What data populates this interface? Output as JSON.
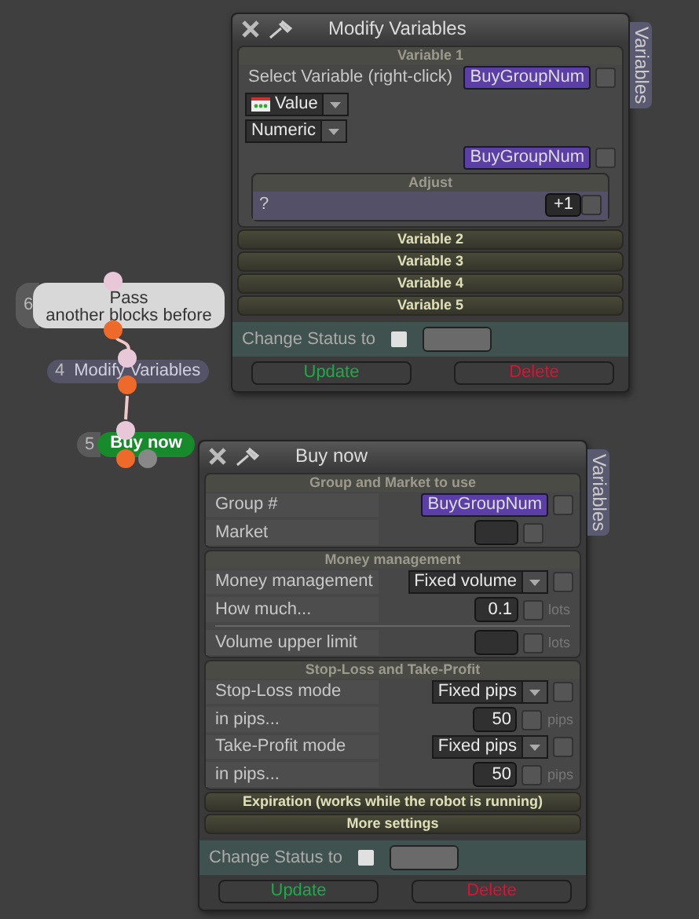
{
  "nodes": [
    {
      "number": "6",
      "label": "Pass\nanother blocks before",
      "kind": "light",
      "extra_port": false
    },
    {
      "number": "4",
      "label": "Modify Variables",
      "kind": "dark",
      "extra_port": false
    },
    {
      "number": "5",
      "label": "Buy now",
      "kind": "action",
      "extra_port": true
    }
  ],
  "dialogs": [
    {
      "kind": "variables",
      "title": "Modify Variables",
      "side_tab": "Variables",
      "sections": [
        {
          "title": "Variable 1",
          "expanded": true,
          "rows": [
            {
              "kind": "variable",
              "label": "Select Variable (right-click)",
              "value": "BuyGroupNum",
              "checked": false
            },
            {
              "kind": "type-dropdown",
              "value": "Value"
            },
            {
              "kind": "dropdown",
              "value": "Numeric"
            },
            {
              "kind": "variable",
              "value": "BuyGroupNum",
              "checked": false
            },
            {
              "kind": "adjust",
              "title": "Adjust",
              "value": "?",
              "button": "+1",
              "checked": false
            }
          ]
        },
        {
          "title": "Variable 2",
          "expanded": false
        },
        {
          "title": "Variable 3",
          "expanded": false
        },
        {
          "title": "Variable 4",
          "expanded": false
        },
        {
          "title": "Variable 5",
          "expanded": false
        }
      ],
      "status": {
        "label": "Change Status to",
        "checked": false
      },
      "buttons": [
        {
          "label": "Update",
          "kind": "update"
        },
        {
          "label": "Delete",
          "kind": "delete"
        }
      ]
    },
    {
      "kind": "action",
      "title": "Buy now",
      "side_tab": "Variables",
      "sections": [
        {
          "title": "Group and Market to use",
          "expanded": true,
          "rows": [
            {
              "kind": "variable",
              "label": "Group #",
              "value": "BuyGroupNum",
              "checked": false
            },
            {
              "kind": "field",
              "label": "Market",
              "checked": false
            }
          ]
        },
        {
          "title": "Money management",
          "expanded": true,
          "rows": [
            {
              "kind": "dropdown",
              "label": "Money management",
              "value": "Fixed volume",
              "checked": false
            },
            {
              "kind": "field",
              "label": "How much...",
              "value": "0.1",
              "unit": "lots",
              "checked": false
            },
            {
              "kind": "divider"
            },
            {
              "kind": "field",
              "label": "Volume upper limit",
              "unit": "lots",
              "checked": false
            }
          ]
        },
        {
          "title": "Stop-Loss and Take-Profit",
          "expanded": true,
          "rows": [
            {
              "kind": "dropdown",
              "label": "Stop-Loss mode",
              "value": "Fixed pips",
              "checked": false
            },
            {
              "kind": "field",
              "label": "in pips...",
              "value": "50",
              "unit": "pips",
              "checked": false
            },
            {
              "kind": "dropdown",
              "label": "Take-Profit mode",
              "value": "Fixed pips",
              "checked": false
            },
            {
              "kind": "field",
              "label": "in pips...",
              "value": "50",
              "unit": "pips",
              "checked": false
            }
          ]
        },
        {
          "title": "Expiration (works while the robot is running)",
          "expanded": false
        },
        {
          "title": "More settings",
          "expanded": false
        }
      ],
      "status": {
        "label": "Change Status to",
        "checked": false
      },
      "buttons": [
        {
          "label": "Update",
          "kind": "update"
        },
        {
          "label": "Delete",
          "kind": "delete"
        }
      ]
    }
  ]
}
